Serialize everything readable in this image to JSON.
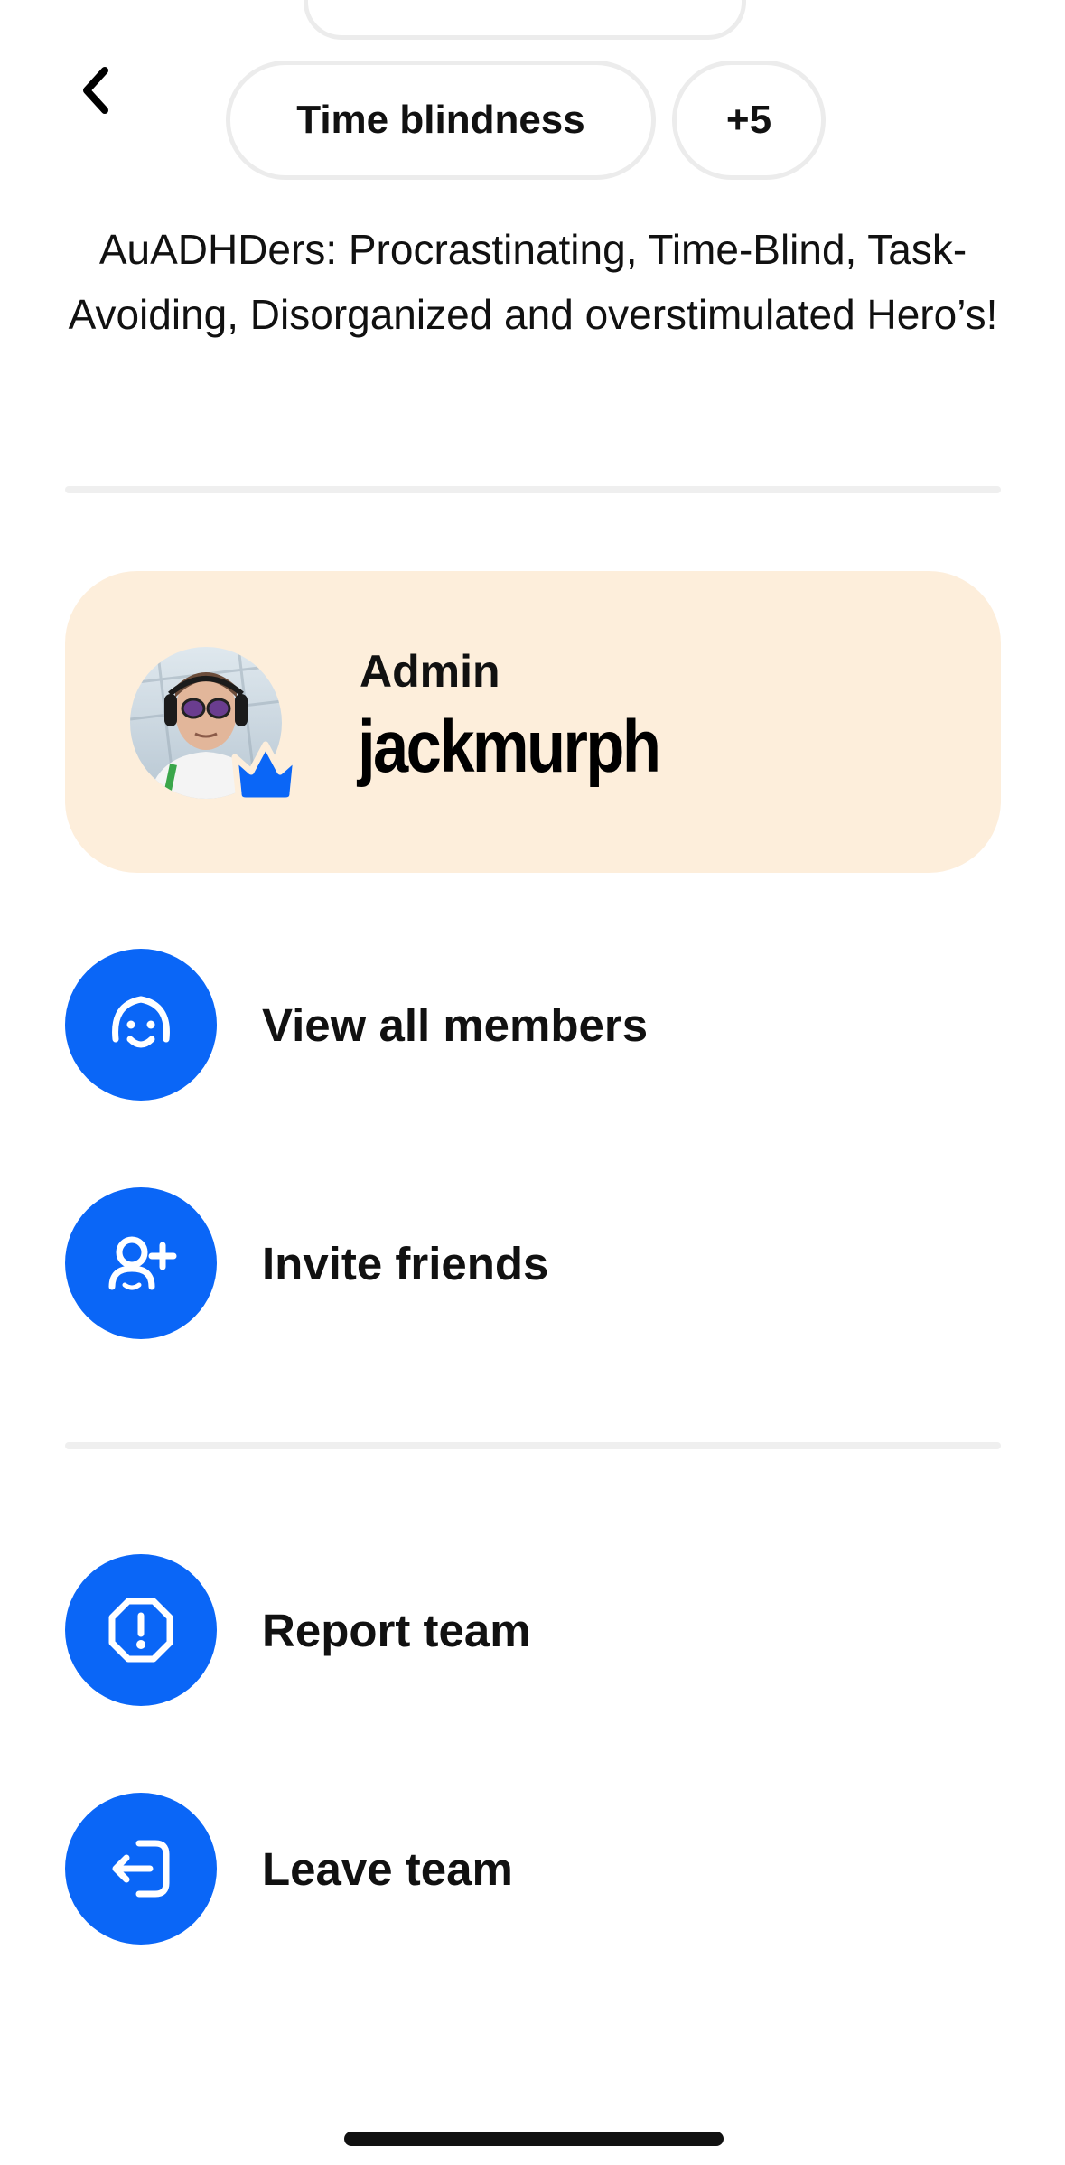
{
  "tags": [
    {
      "label": "Time blindness"
    },
    {
      "label": "+5"
    }
  ],
  "description": "AuADHDers: Procrastinating, Time-Blind, Task-Avoiding, Disorganized and overstimulated Hero’s!",
  "admin": {
    "role": "Admin",
    "username": "jackmurph"
  },
  "actions": [
    {
      "label": "View all members",
      "icon": "smile-face-icon"
    },
    {
      "label": "Invite friends",
      "icon": "add-person-icon"
    },
    {
      "label": "Report team",
      "icon": "alert-octagon-icon"
    },
    {
      "label": "Leave team",
      "icon": "exit-icon"
    }
  ],
  "colors": {
    "accent": "#0a66f7",
    "admin_card_bg": "#fdeedb",
    "divider": "#efefef"
  }
}
